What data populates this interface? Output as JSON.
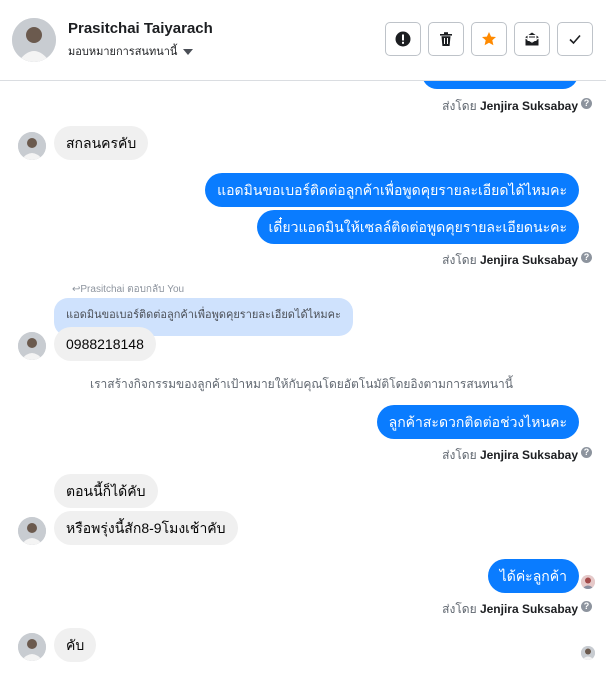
{
  "header": {
    "name": "Prasitchai Taiyarach",
    "assign_label": "มอบหมายการสนทนานี้",
    "actions": [
      "report-icon",
      "trash-icon",
      "star-icon",
      "mail-icon",
      "check-icon"
    ],
    "accent": "#ff8a00"
  },
  "sender_name": "Jenjira Suksabay",
  "sent_prefix": "ส่งโดย",
  "messages": {
    "m1": "สกลนครคับ",
    "m2": "แอดมินขอเบอร์ติดต่อลูกค้าเพื่อพูดคุยรายละเอียดได้ไหมคะ",
    "m3": "เดี๋ยวแอดมินให้เซลล์ติดต่อพูดคุยรายละเอียดนะคะ",
    "reply_label": "Prasitchai ตอบกลับ You",
    "quoted": "แอดมินขอเบอร์ติดต่อลูกค้าเพื่อพูดคุยรายละเอียดได้ไหมคะ",
    "m4": "0988218148",
    "system": "เราสร้างกิจกรรมของลูกค้าเป้าหมายให้กับคุณโดยอัตโนมัติโดยอิงตามการสนทนานี้",
    "m5": "ลูกค้าสะดวกติดต่อช่วงไหนคะ",
    "m6": "ตอนนี้ก็ได้คับ",
    "m7": "หรือพรุ่งนี้สัก8-9โมงเช้าคับ",
    "m8": "ได้ค่ะลูกค้า",
    "m9": "คับ"
  },
  "colors": {
    "outgoing": "#0a7cff",
    "incoming": "#f0f0f0",
    "quoted": "#cfe2fd"
  }
}
